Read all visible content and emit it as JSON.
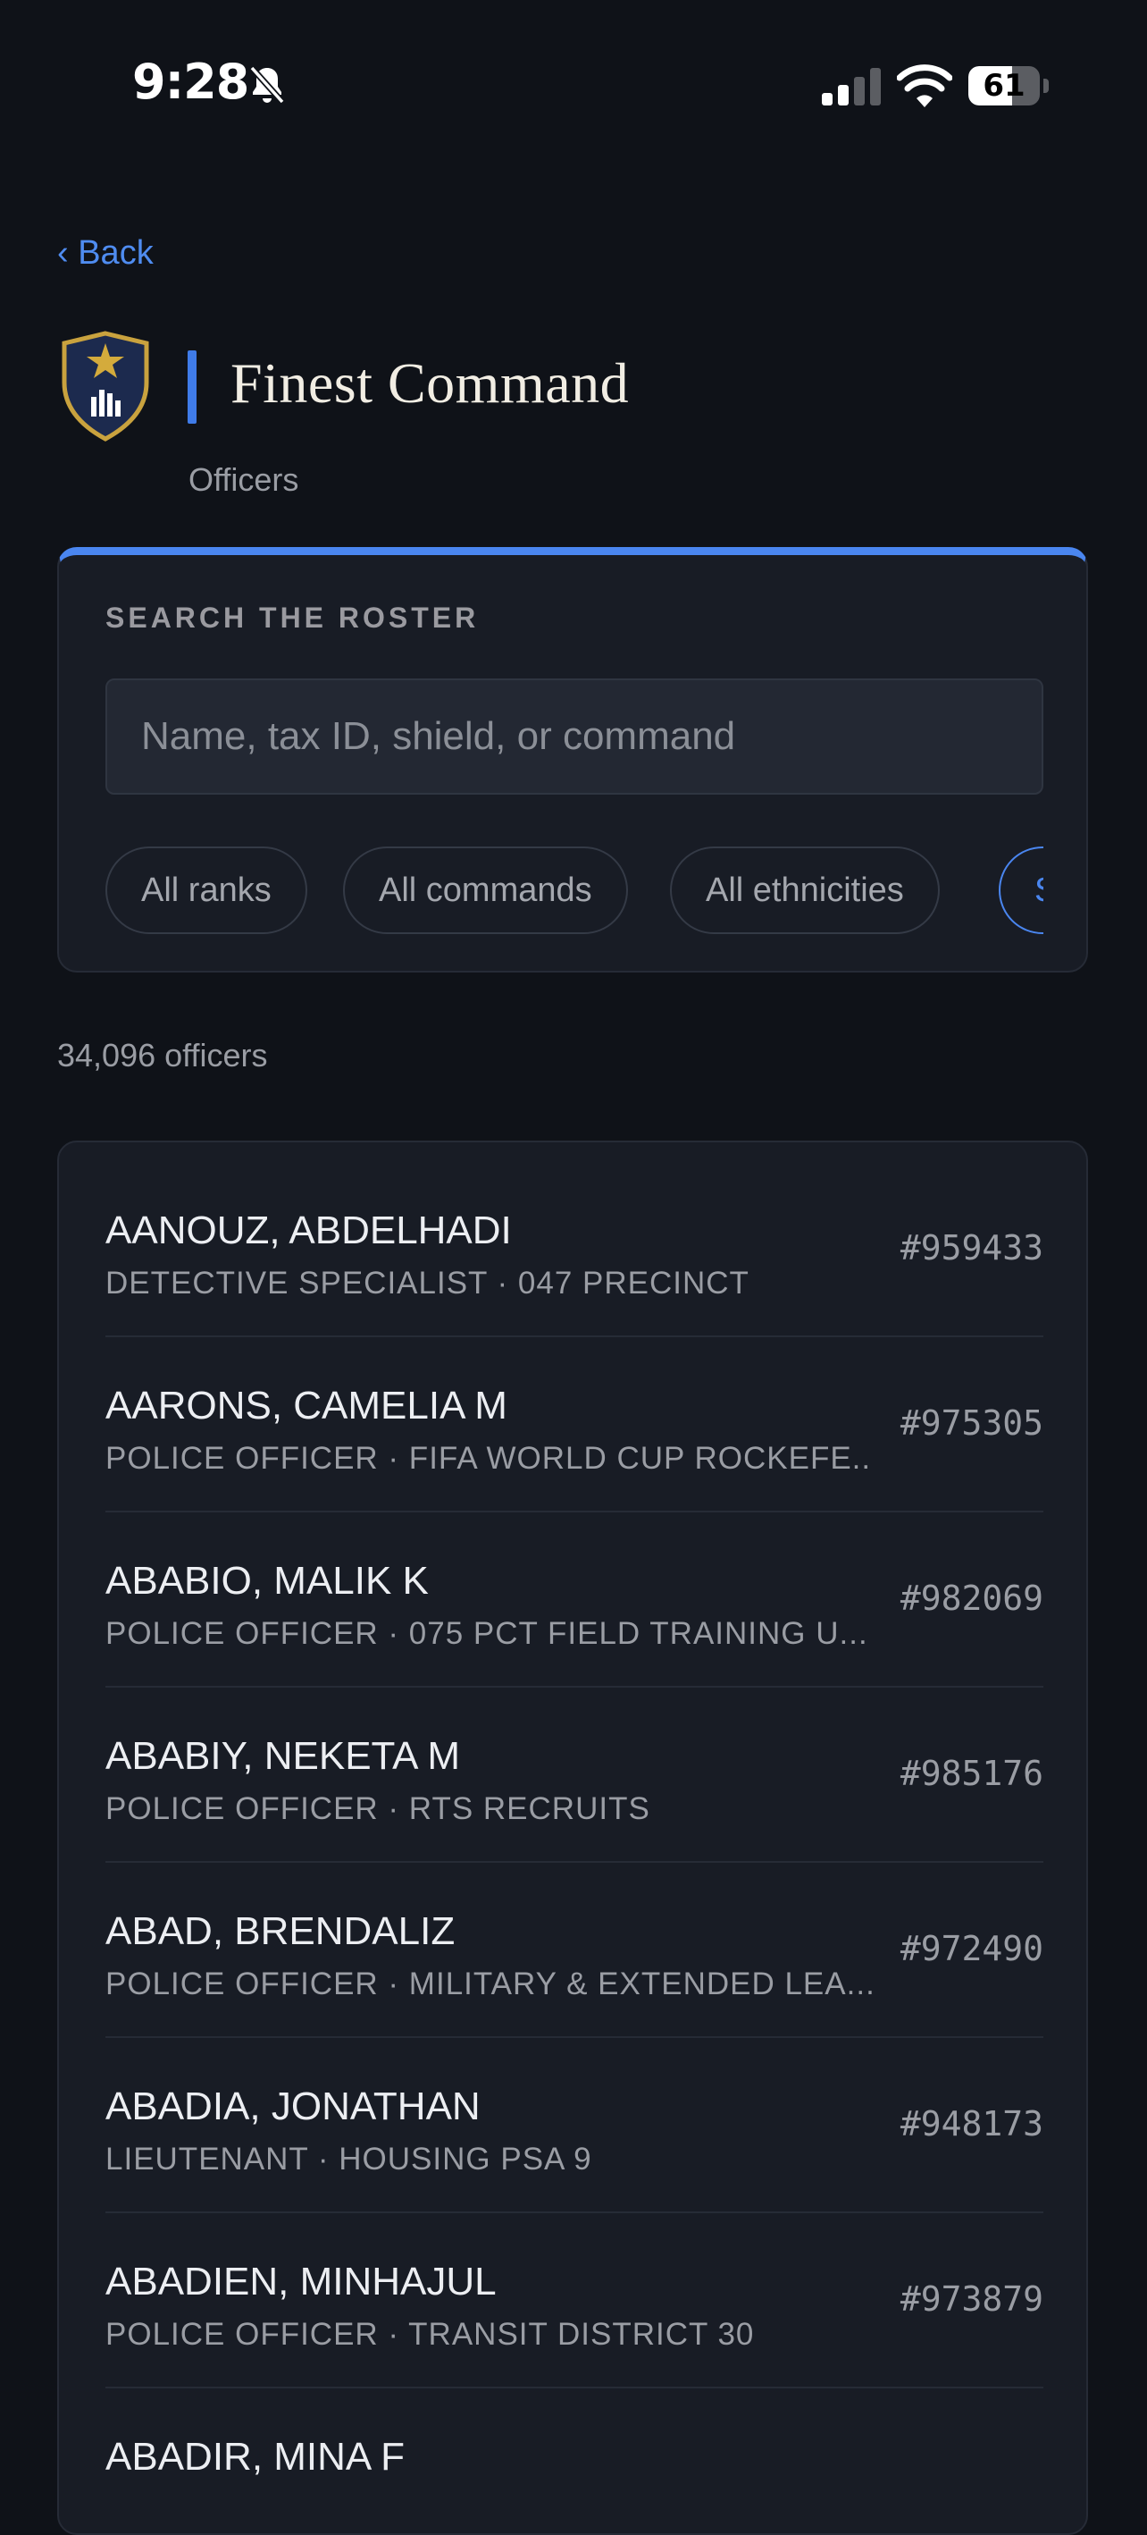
{
  "status_bar": {
    "time": "9:28",
    "battery_percent": 61,
    "battery_label": "61",
    "icons": [
      "bell-slash-icon",
      "cellular-signal-icon",
      "wifi-icon",
      "battery-icon"
    ]
  },
  "header": {
    "back_label": "‹ Back",
    "app_title": "Finest Command",
    "subtitle": "Officers",
    "logo_icon": "shield-star-icon"
  },
  "search": {
    "heading": "SEARCH THE ROSTER",
    "placeholder": "Name, tax ID, shield, or command",
    "value": "",
    "filters": [
      {
        "label": "All ranks",
        "active": false
      },
      {
        "label": "All commands",
        "active": false
      },
      {
        "label": "All ethnicities",
        "active": false
      },
      {
        "label": "S",
        "active": true
      }
    ]
  },
  "results": {
    "count_label": "34,096 officers"
  },
  "officers": [
    {
      "name": "AANOUZ, ABDELHADI",
      "detail": "DETECTIVE SPECIALIST · 047 PRECINCT",
      "shield": "#959433"
    },
    {
      "name": "AARONS, CAMELIA M",
      "detail": "POLICE OFFICER · FIFA WORLD CUP ROCKEFE...",
      "shield": "#975305"
    },
    {
      "name": "ABABIO, MALIK K",
      "detail": "POLICE OFFICER · 075 PCT FIELD TRAINING U...",
      "shield": "#982069"
    },
    {
      "name": "ABABIY, NEKETA M",
      "detail": "POLICE OFFICER · RTS RECRUITS",
      "shield": "#985176"
    },
    {
      "name": "ABAD, BRENDALIZ",
      "detail": "POLICE OFFICER · MILITARY & EXTENDED LEA...",
      "shield": "#972490"
    },
    {
      "name": "ABADIA, JONATHAN",
      "detail": "LIEUTENANT · HOUSING PSA 9",
      "shield": "#948173"
    },
    {
      "name": "ABADIEN, MINHAJUL",
      "detail": "POLICE OFFICER · TRANSIT DISTRICT 30",
      "shield": "#973879"
    },
    {
      "name": "ABADIR, MINA F",
      "detail": "",
      "shield": ""
    }
  ],
  "colors": {
    "background": "#0f1218",
    "card": "#181c25",
    "accent": "#4a86f0",
    "text_muted": "#9a9da4"
  }
}
